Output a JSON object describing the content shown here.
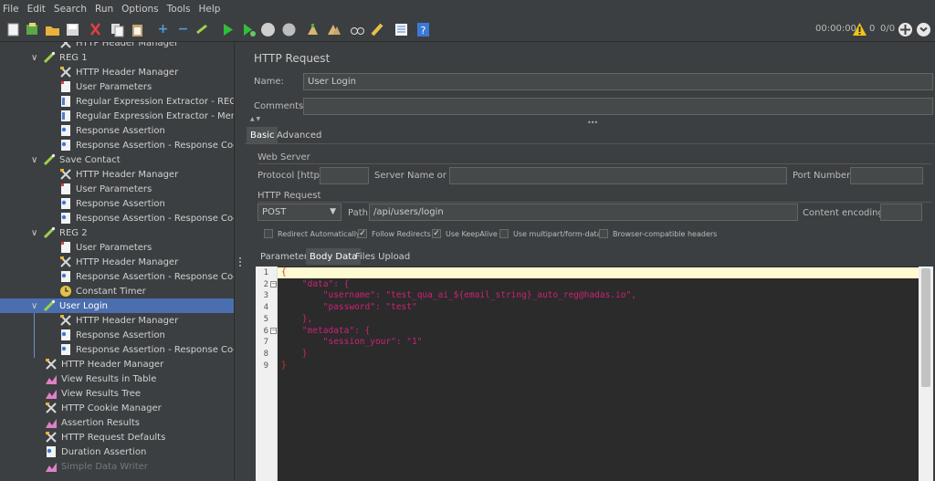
{
  "menu": [
    "File",
    "Edit",
    "Search",
    "Run",
    "Options",
    "Tools",
    "Help"
  ],
  "toolbar": {
    "icons": [
      "new-icon",
      "templates-icon",
      "open-icon",
      "save-icon",
      "cut-icon",
      "copy-icon",
      "paste-icon",
      "expand-icon",
      "collapse-icon",
      "toggle-icon",
      "start-icon",
      "start-no-pause-icon",
      "stop-icon",
      "shutdown-icon",
      "clear-icon",
      "clear-all-icon",
      "search-icon",
      "reset-search-icon",
      "function-helper-icon",
      "help-icon"
    ],
    "timer": "00:00:00",
    "warnings": "0",
    "threads": "0/0"
  },
  "tree": {
    "items": [
      {
        "label": "HTTP Header Manager",
        "icon": "header-manager-icon"
      },
      {
        "label": "REG 1",
        "icon": "controller-icon"
      },
      {
        "label": "HTTP Header Manager",
        "icon": "header-manager-icon"
      },
      {
        "label": "User Parameters",
        "icon": "preprocessor-icon"
      },
      {
        "label": "Regular Expression Extractor - REG LOGG",
        "icon": "extractor-icon"
      },
      {
        "label": "Regular Expression Extractor - Member I",
        "icon": "extractor-icon"
      },
      {
        "label": "Response Assertion",
        "icon": "assertion-icon"
      },
      {
        "label": "Response Assertion - Response Code",
        "icon": "assertion-icon"
      },
      {
        "label": "Save Contact",
        "icon": "controller-icon"
      },
      {
        "label": "HTTP Header Manager",
        "icon": "header-manager-icon"
      },
      {
        "label": "User Parameters",
        "icon": "preprocessor-icon"
      },
      {
        "label": "Response Assertion",
        "icon": "assertion-icon"
      },
      {
        "label": "Response Assertion - Response Code",
        "icon": "assertion-icon"
      },
      {
        "label": "REG 2",
        "icon": "controller-icon"
      },
      {
        "label": "User Parameters",
        "icon": "preprocessor-icon"
      },
      {
        "label": "HTTP Header Manager",
        "icon": "header-manager-icon"
      },
      {
        "label": "Response Assertion - Response Code",
        "icon": "assertion-icon"
      },
      {
        "label": "Constant Timer",
        "icon": "timer-icon"
      },
      {
        "label": "User Login",
        "icon": "controller-icon"
      },
      {
        "label": "HTTP Header Manager",
        "icon": "header-manager-icon"
      },
      {
        "label": "Response Assertion",
        "icon": "assertion-icon"
      },
      {
        "label": "Response Assertion - Response Code",
        "icon": "assertion-icon"
      },
      {
        "label": "HTTP Header Manager",
        "icon": "header-manager-icon"
      },
      {
        "label": "View Results in Table",
        "icon": "listener-icon"
      },
      {
        "label": "View Results Tree",
        "icon": "listener-icon"
      },
      {
        "label": "HTTP Cookie Manager",
        "icon": "header-manager-icon"
      },
      {
        "label": "Assertion Results",
        "icon": "listener-icon"
      },
      {
        "label": "HTTP Request Defaults",
        "icon": "header-manager-icon"
      },
      {
        "label": "Duration Assertion",
        "icon": "assertion-icon"
      },
      {
        "label": "Simple Data Writer",
        "icon": "listener-icon"
      }
    ]
  },
  "panel": {
    "title": "HTTP Request",
    "name_label": "Name:",
    "name_value": "User Login",
    "comments_label": "Comments:",
    "comments_value": "",
    "tabs": [
      "Basic",
      "Advanced"
    ],
    "web_server_title": "Web Server",
    "protocol_label": "Protocol [http]:",
    "protocol_value": "",
    "server_label": "Server Name or IP:",
    "server_value": "",
    "port_label": "Port Number:",
    "port_value": "",
    "http_request_title": "HTTP Request",
    "method": "POST",
    "path_label": "Path:",
    "path_value": "/api/users/login",
    "encoding_label": "Content encoding:",
    "encoding_value": "",
    "checkboxes": [
      {
        "label": "Redirect Automatically",
        "checked": false
      },
      {
        "label": "Follow Redirects",
        "checked": true
      },
      {
        "label": "Use KeepAlive",
        "checked": true
      },
      {
        "label": "Use multipart/form-data",
        "checked": false
      },
      {
        "label": "Browser-compatible headers",
        "checked": false
      }
    ],
    "subtabs": [
      "Parameters",
      "Body Data",
      "Files Upload"
    ]
  },
  "editor": {
    "line_numbers": [
      "1",
      "2",
      "3",
      "4",
      "5",
      "6",
      "7",
      "8",
      "9"
    ],
    "lines": [
      "{",
      "    \"data\": {",
      "        \"username\": \"test_qua_ai_${email_string}_auto_reg@hadas.io\",",
      "        \"password\": \"test\"",
      "    },",
      "    \"metadata\": {",
      "        \"session_your\": \"1\"",
      "    }",
      "}"
    ]
  },
  "colors": {
    "background": "#3c3f41",
    "selection": "#4b6eaf",
    "editor_background": "#2b2b2b",
    "current_line": "#fffbd0"
  }
}
